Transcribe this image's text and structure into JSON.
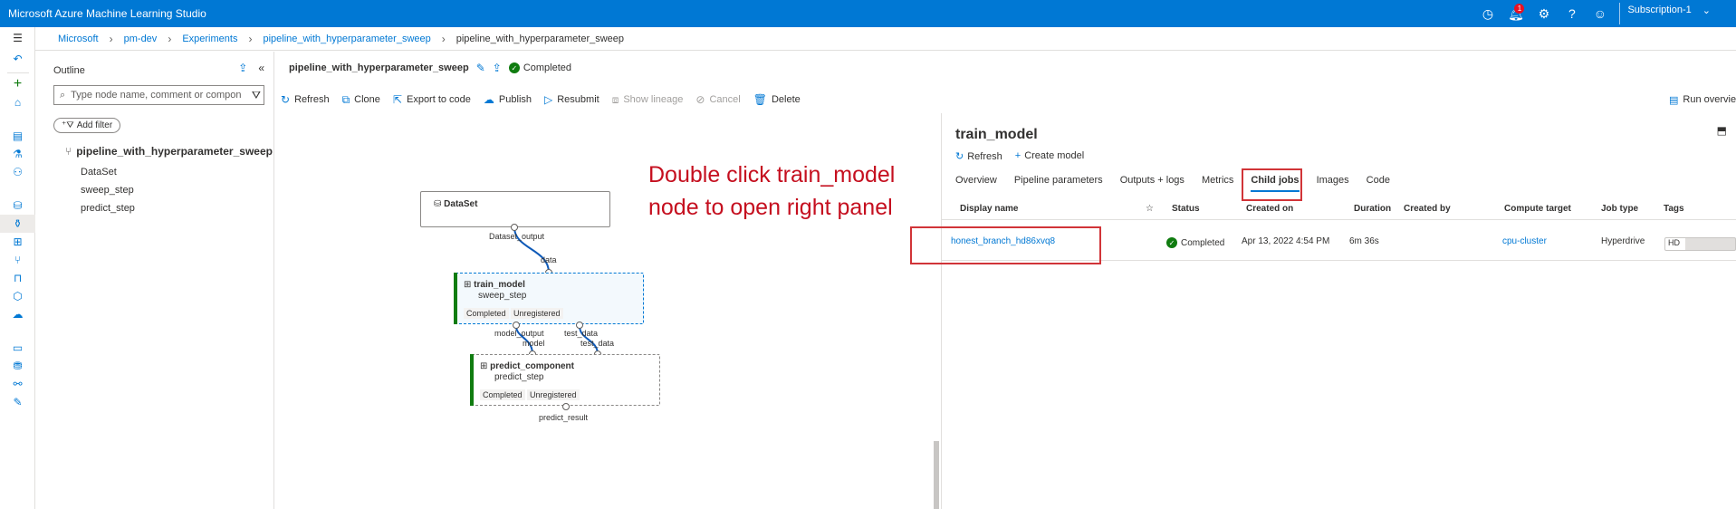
{
  "app": {
    "title": "Microsoft Azure Machine Learning Studio"
  },
  "topbar": {
    "notification_count": "1",
    "subscription_label": "Subscription-1"
  },
  "breadcrumb": {
    "items": [
      "Microsoft",
      "pm-dev",
      "Experiments",
      "pipeline_with_hyperparameter_sweep"
    ],
    "current": "pipeline_with_hyperparameter_sweep"
  },
  "outline": {
    "title": "Outline",
    "search_placeholder": "Type node name, comment or compon",
    "add_filter": "Add filter",
    "root": "pipeline_with_hyperparameter_sweep",
    "items": [
      "DataSet",
      "sweep_step",
      "predict_step"
    ]
  },
  "pipeline": {
    "name": "pipeline_with_hyperparameter_sweep",
    "status": "Completed"
  },
  "toolbar": {
    "refresh": "Refresh",
    "clone": "Clone",
    "export": "Export to code",
    "publish": "Publish",
    "resubmit": "Resubmit",
    "lineage": "Show lineage",
    "cancel": "Cancel",
    "delete": "Delete",
    "run_overview": "Run overview"
  },
  "graph": {
    "dataset": {
      "title": "DataSet",
      "output": "Dataset_output"
    },
    "train": {
      "input": "data",
      "title": "train_model",
      "subtitle": "sweep_step",
      "status": "Completed",
      "registration": "Unregistered",
      "out1": "model_output",
      "out2": "test_data"
    },
    "predict": {
      "in1": "model",
      "in2": "test_data",
      "title": "predict_component",
      "subtitle": "predict_step",
      "status": "Completed",
      "registration": "Unregistered",
      "output": "predict_result"
    }
  },
  "annotation": {
    "line1": "Double click train_model",
    "line2": "node to open right panel"
  },
  "right_panel": {
    "title": "train_model",
    "refresh": "Refresh",
    "create_model": "Create model",
    "tabs": [
      "Overview",
      "Pipeline parameters",
      "Outputs + logs",
      "Metrics",
      "Child jobs",
      "Images",
      "Code"
    ],
    "active_tab": "Child jobs",
    "columns": [
      "Display name",
      "Status",
      "Created on",
      "Duration",
      "Created by",
      "Compute target",
      "Job type",
      "Tags"
    ],
    "rows": [
      {
        "display_name": "honest_branch_hd86xvq8",
        "status": "Completed",
        "created_on": "Apr 13, 2022 4:54 PM",
        "duration": "6m 36s",
        "created_by": "",
        "compute_target": "cpu-cluster",
        "job_type": "Hyperdrive",
        "tags": "HD"
      }
    ]
  },
  "colors": {
    "brand": "#0078d4",
    "success": "#107c10",
    "highlight": "#d13438"
  }
}
